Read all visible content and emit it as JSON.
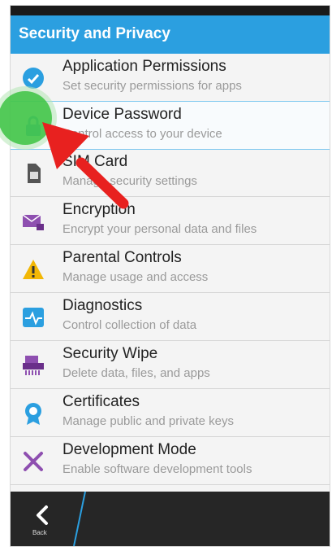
{
  "header": {
    "title": "Security and Privacy"
  },
  "colors": {
    "accent": "#2b9fe0",
    "pointer_arrow": "#e8211f",
    "touch_indicator": "#45c64b"
  },
  "items": [
    {
      "label": "Application Permissions",
      "sub": "Set security permissions for apps",
      "icon": "shield-gear-icon"
    },
    {
      "label": "Device Password",
      "sub": "Control access to your device",
      "icon": "lock-icon"
    },
    {
      "label": "SIM Card",
      "sub": "Manage security settings",
      "icon": "sim-card-icon"
    },
    {
      "label": "Encryption",
      "sub": "Encrypt your personal data and files",
      "icon": "encrypted-mail-icon"
    },
    {
      "label": "Parental Controls",
      "sub": "Manage usage and access",
      "icon": "warning-icon"
    },
    {
      "label": "Diagnostics",
      "sub": "Control collection of data",
      "icon": "pulse-icon"
    },
    {
      "label": "Security Wipe",
      "sub": "Delete data, files, and apps",
      "icon": "shredder-icon"
    },
    {
      "label": "Certificates",
      "sub": "Manage public and private keys",
      "icon": "certificate-icon"
    },
    {
      "label": "Development Mode",
      "sub": "Enable software development tools",
      "icon": "tools-icon"
    }
  ],
  "bottom": {
    "back_label": "Back"
  }
}
